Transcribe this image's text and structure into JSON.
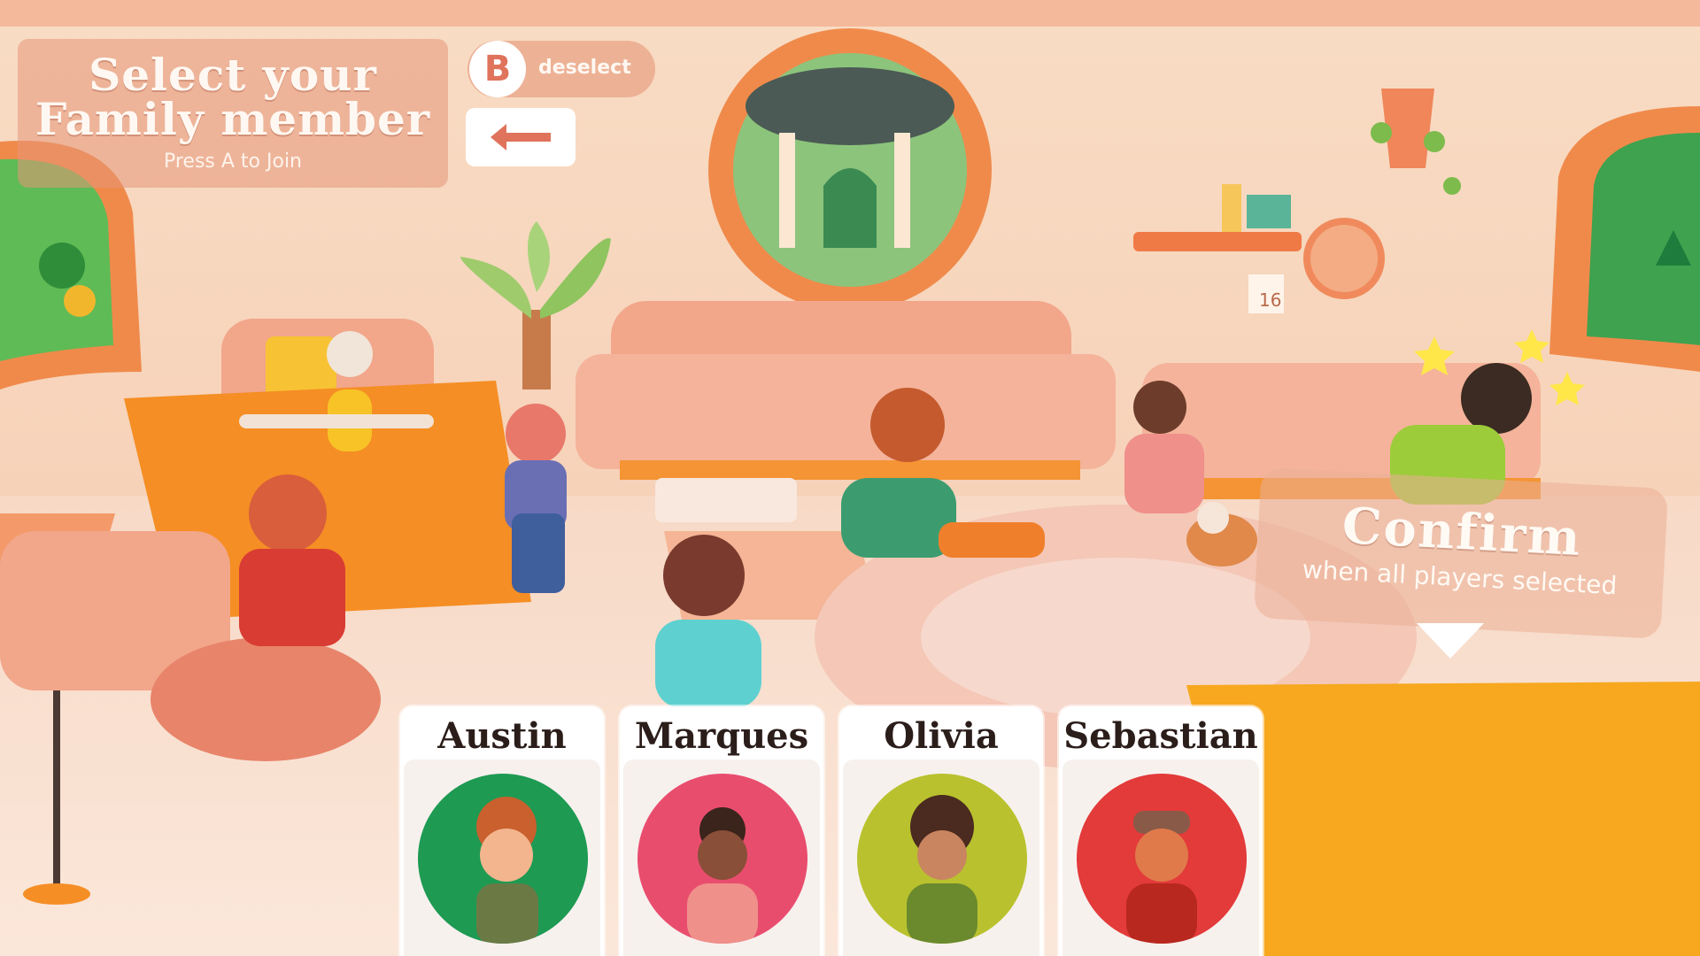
{
  "header": {
    "title_line1": "Select your",
    "title_line2": "Family member",
    "join_hint": "Press A to Join"
  },
  "controls": {
    "deselect_button_glyph": "B",
    "deselect_label": "deselect",
    "back_icon": "left-arrow-icon"
  },
  "confirm": {
    "title": "Confirm",
    "subtitle": "when all players selected",
    "arrow_icon": "down-triangle-icon"
  },
  "room": {
    "calendar_day": "16"
  },
  "characters": [
    {
      "name": "Austin",
      "bg_color": "#1e9a52"
    },
    {
      "name": "Marques",
      "bg_color": "#e94d6e"
    },
    {
      "name": "Olivia",
      "bg_color": "#b9c22e"
    },
    {
      "name": "Sebastian",
      "bg_color": "#e33a3a"
    }
  ],
  "colors": {
    "wall": "#f6d2b8",
    "accent_orange": "#f08a4b",
    "rug_yellow": "#f7a81e",
    "panel_overlay": "#e6967a"
  }
}
